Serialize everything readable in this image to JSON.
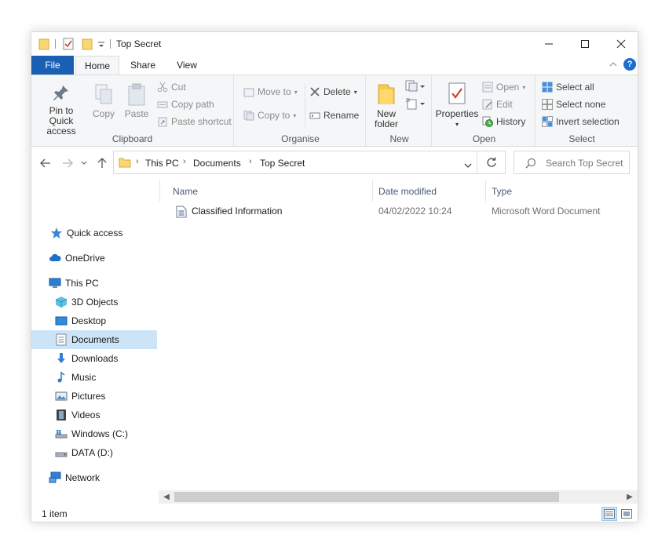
{
  "window": {
    "title": "Top Secret"
  },
  "ribbon_tabs": [
    {
      "label": "File"
    },
    {
      "label": "Home"
    },
    {
      "label": "Share"
    },
    {
      "label": "View"
    }
  ],
  "ribbon": {
    "clipboard": {
      "pin_label": "Pin to Quick access",
      "pin_line1": "Pin to Quick",
      "pin_line2": "access",
      "copy_label": "Copy",
      "paste_label": "Paste",
      "cut_label": "Cut",
      "copy_path_label": "Copy path",
      "paste_shortcut_label": "Paste shortcut",
      "group_label": "Clipboard"
    },
    "organise": {
      "move_to_label": "Move to",
      "copy_to_label": "Copy to",
      "delete_label": "Delete",
      "rename_label": "Rename",
      "group_label": "Organise"
    },
    "new": {
      "new_folder_line1": "New",
      "new_folder_line2": "folder",
      "group_label": "New"
    },
    "open": {
      "properties_label": "Properties",
      "open_label": "Open",
      "edit_label": "Edit",
      "history_label": "History",
      "group_label": "Open"
    },
    "select": {
      "select_all_label": "Select all",
      "select_none_label": "Select none",
      "invert_label": "Invert selection",
      "group_label": "Select"
    }
  },
  "address": {
    "crumbs": [
      "This PC",
      "Documents",
      "Top Secret"
    ],
    "search_placeholder": "Search Top Secret"
  },
  "nav_pane": {
    "items": [
      {
        "label": "Quick access",
        "icon": "star-icon"
      },
      {
        "label": "OneDrive",
        "icon": "cloud-icon"
      },
      {
        "label": "This PC",
        "icon": "monitor-icon"
      },
      {
        "label": "3D Objects",
        "icon": "cube-icon"
      },
      {
        "label": "Desktop",
        "icon": "desktop-icon"
      },
      {
        "label": "Documents",
        "icon": "document-icon",
        "selected": true
      },
      {
        "label": "Downloads",
        "icon": "download-arrow-icon"
      },
      {
        "label": "Music",
        "icon": "music-note-icon"
      },
      {
        "label": "Pictures",
        "icon": "picture-icon"
      },
      {
        "label": "Videos",
        "icon": "film-icon"
      },
      {
        "label": "Windows (C:)",
        "icon": "drive-windows-icon"
      },
      {
        "label": "DATA (D:)",
        "icon": "drive-icon"
      },
      {
        "label": "Network",
        "icon": "network-icon"
      }
    ]
  },
  "file_list": {
    "columns": [
      "Name",
      "Date modified",
      "Type"
    ],
    "rows": [
      {
        "name": "Classified Information",
        "date_modified": "04/02/2022 10:24",
        "type": "Microsoft Word Document"
      }
    ]
  },
  "status": {
    "item_count": "1 item"
  },
  "colors": {
    "accent": "#1a5fb4",
    "selection": "#cce4f7",
    "ribbon_bg": "#f5f6f7"
  }
}
